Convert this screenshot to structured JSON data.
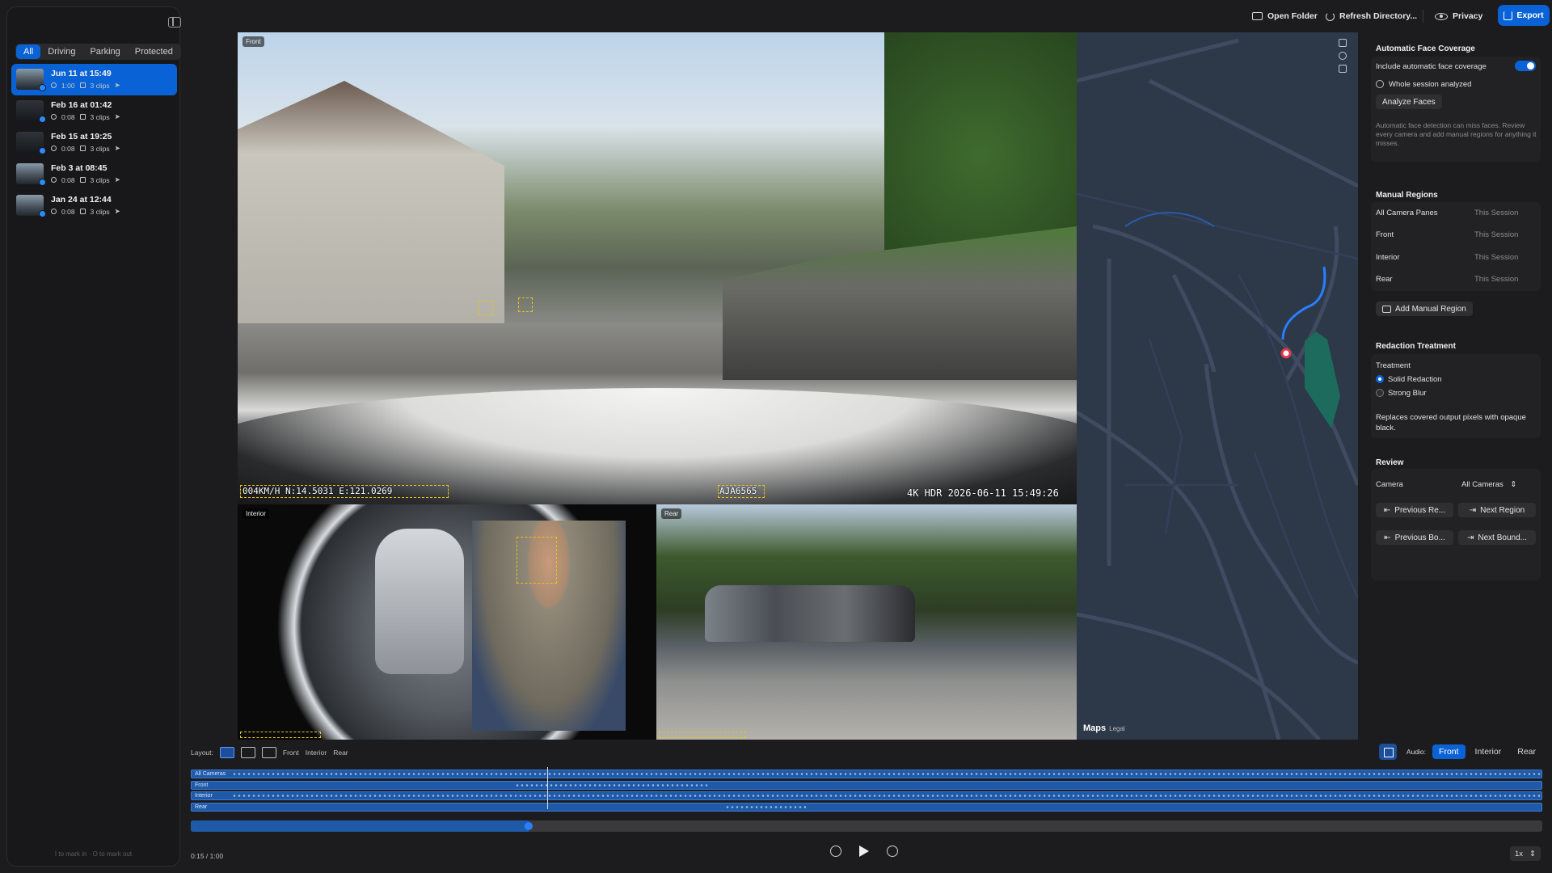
{
  "sidebar": {
    "filters": [
      "All",
      "Driving",
      "Parking",
      "Protected"
    ],
    "items": [
      {
        "title": "Jun 11 at 15:49",
        "duration": "1:00",
        "clips": "3 clips"
      },
      {
        "title": "Feb 16 at 01:42",
        "duration": "0:08",
        "clips": "3 clips"
      },
      {
        "title": "Feb 15 at 19:25",
        "duration": "0:08",
        "clips": "3 clips"
      },
      {
        "title": "Feb 3 at 08:45",
        "duration": "0:08",
        "clips": "3 clips"
      },
      {
        "title": "Jan 24 at 12:44",
        "duration": "0:08",
        "clips": "3 clips"
      }
    ],
    "hint": "I to mark in · O to mark out"
  },
  "toolbar": {
    "open_folder": "Open Folder",
    "refresh": "Refresh Directory...",
    "privacy": "Privacy",
    "export": "Export"
  },
  "video": {
    "front_label": "Front",
    "interior_label": "Interior",
    "rear_label": "Rear",
    "osd_left": "004KM/H N:14.5031 E:121.0269",
    "osd_plate": "AJA6565",
    "osd_right": "4K HDR 2026-06-11 15:49:26"
  },
  "map": {
    "logo": "Maps",
    "legal": "Legal"
  },
  "right_panel": {
    "face": {
      "title": "Automatic Face Coverage",
      "include_label": "Include automatic face coverage",
      "include_on": true,
      "status": "Whole session analyzed",
      "analyze_btn": "Analyze Faces",
      "note": "Automatic face detection can miss faces. Review every camera and add manual regions for anything it misses."
    },
    "manual": {
      "title": "Manual Regions",
      "rows": [
        {
          "label": "All Camera Panes",
          "value": "This Session"
        },
        {
          "label": "Front",
          "value": "This Session"
        },
        {
          "label": "Interior",
          "value": "This Session"
        },
        {
          "label": "Rear",
          "value": "This Session"
        }
      ],
      "add_btn": "Add Manual Region"
    },
    "treatment": {
      "title": "Redaction Treatment",
      "label": "Treatment",
      "options": [
        "Solid Redaction",
        "Strong Blur"
      ],
      "selected": "Solid Redaction",
      "note": "Replaces covered output pixels with opaque black."
    },
    "review": {
      "title": "Review",
      "camera_label": "Camera",
      "camera_value": "All Cameras",
      "prev_region": "Previous Re...",
      "next_region": "Next Region",
      "prev_bound": "Previous Bo...",
      "next_bound": "Next Bound..."
    }
  },
  "bottom": {
    "layout_label": "Layout:",
    "layout_options": [
      "Front",
      "Interior",
      "Rear"
    ],
    "audio_label": "Audio:",
    "audio_options": [
      "Front",
      "Interior",
      "Rear"
    ],
    "audio_selected": "Front",
    "tracks": [
      "All Cameras",
      "Front",
      "Interior",
      "Rear"
    ],
    "current_time": "0:15",
    "total_time": "1:00",
    "progress": 0.25,
    "speed": "1x"
  }
}
